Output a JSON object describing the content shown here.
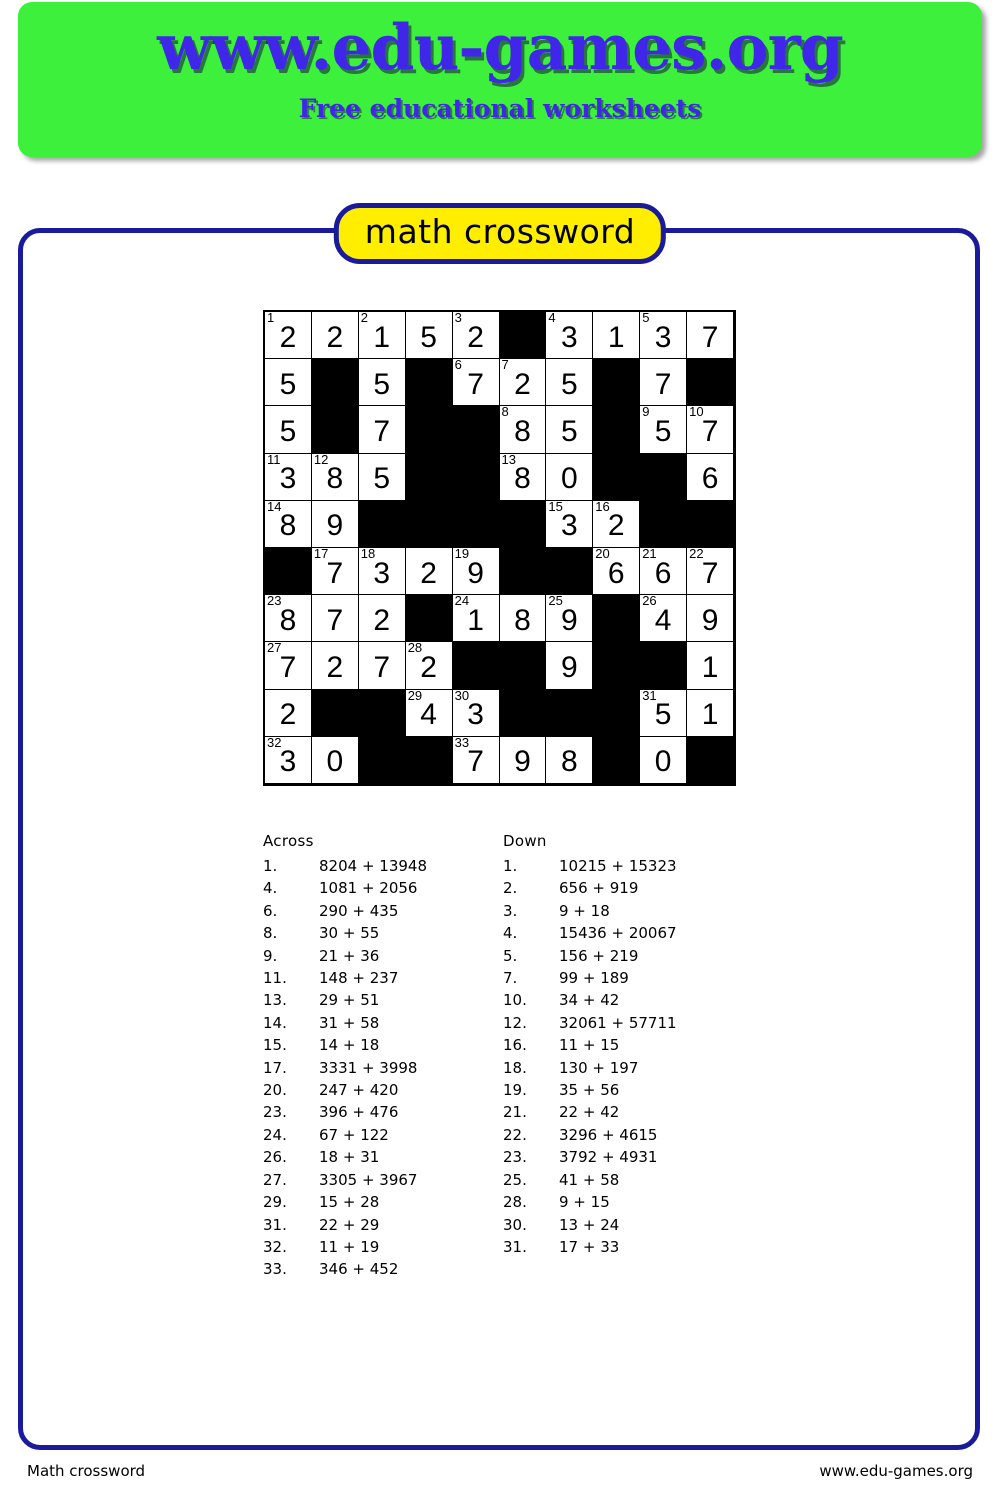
{
  "banner": {
    "title": "www.edu-games.org",
    "subtitle": "Free educational worksheets",
    "bg_color": "#3cf03c",
    "text_color": "#4026e8"
  },
  "title_badge": {
    "label": "math crossword",
    "bg_color": "#ffee00",
    "border_color": "#1a1a9c"
  },
  "footer": {
    "left": "Math crossword",
    "right": "www.edu-games.org"
  },
  "grid": {
    "rows": 10,
    "cols": 10,
    "cells": [
      [
        {
          "v": "2",
          "n": "1"
        },
        {
          "v": "2"
        },
        {
          "v": "1",
          "n": "2"
        },
        {
          "v": "5"
        },
        {
          "v": "2",
          "n": "3"
        },
        null,
        {
          "v": "3",
          "n": "4"
        },
        {
          "v": "1"
        },
        {
          "v": "3",
          "n": "5"
        },
        {
          "v": "7"
        }
      ],
      [
        {
          "v": "5"
        },
        null,
        {
          "v": "5"
        },
        null,
        {
          "v": "7",
          "n": "6"
        },
        {
          "v": "2",
          "n": "7"
        },
        {
          "v": "5"
        },
        null,
        {
          "v": "7"
        },
        null
      ],
      [
        {
          "v": "5"
        },
        null,
        {
          "v": "7"
        },
        null,
        null,
        {
          "v": "8",
          "n": "8"
        },
        {
          "v": "5"
        },
        null,
        {
          "v": "5",
          "n": "9"
        },
        {
          "v": "7",
          "n": "10"
        }
      ],
      [
        {
          "v": "3",
          "n": "11"
        },
        {
          "v": "8",
          "n": "12"
        },
        {
          "v": "5"
        },
        null,
        null,
        {
          "v": "8",
          "n": "13"
        },
        {
          "v": "0"
        },
        null,
        null,
        {
          "v": "6"
        }
      ],
      [
        {
          "v": "8",
          "n": "14"
        },
        {
          "v": "9"
        },
        null,
        null,
        null,
        null,
        {
          "v": "3",
          "n": "15"
        },
        {
          "v": "2",
          "n": "16"
        },
        null,
        null
      ],
      [
        null,
        {
          "v": "7",
          "n": "17"
        },
        {
          "v": "3",
          "n": "18"
        },
        {
          "v": "2"
        },
        {
          "v": "9",
          "n": "19"
        },
        null,
        null,
        {
          "v": "6",
          "n": "20"
        },
        {
          "v": "6",
          "n": "21"
        },
        {
          "v": "7",
          "n": "22"
        }
      ],
      [
        {
          "v": "8",
          "n": "23"
        },
        {
          "v": "7"
        },
        {
          "v": "2"
        },
        null,
        {
          "v": "1",
          "n": "24"
        },
        {
          "v": "8"
        },
        {
          "v": "9",
          "n": "25"
        },
        null,
        {
          "v": "4",
          "n": "26"
        },
        {
          "v": "9"
        }
      ],
      [
        {
          "v": "7",
          "n": "27"
        },
        {
          "v": "2"
        },
        {
          "v": "7"
        },
        {
          "v": "2",
          "n": "28"
        },
        null,
        null,
        {
          "v": "9"
        },
        null,
        null,
        {
          "v": "1"
        }
      ],
      [
        {
          "v": "2"
        },
        null,
        null,
        {
          "v": "4",
          "n": "29"
        },
        {
          "v": "3",
          "n": "30"
        },
        null,
        null,
        null,
        {
          "v": "5",
          "n": "31"
        },
        {
          "v": "1"
        }
      ],
      [
        {
          "v": "3",
          "n": "32"
        },
        {
          "v": "0"
        },
        null,
        null,
        {
          "v": "7",
          "n": "33"
        },
        {
          "v": "9"
        },
        {
          "v": "8"
        },
        null,
        {
          "v": "0"
        },
        null
      ]
    ]
  },
  "clues": {
    "across": {
      "heading": "Across",
      "items": [
        {
          "num": "1.",
          "text": "8204 + 13948"
        },
        {
          "num": "4.",
          "text": "1081 + 2056"
        },
        {
          "num": "6.",
          "text": "290 + 435"
        },
        {
          "num": "8.",
          "text": "30 + 55"
        },
        {
          "num": "9.",
          "text": "21 + 36"
        },
        {
          "num": "11.",
          "text": "148 + 237"
        },
        {
          "num": "13.",
          "text": "29 + 51"
        },
        {
          "num": "14.",
          "text": "31 + 58"
        },
        {
          "num": "15.",
          "text": "14 + 18"
        },
        {
          "num": "17.",
          "text": "3331 + 3998"
        },
        {
          "num": "20.",
          "text": "247 + 420"
        },
        {
          "num": "23.",
          "text": "396 + 476"
        },
        {
          "num": "24.",
          "text": "67 + 122"
        },
        {
          "num": "26.",
          "text": "18 + 31"
        },
        {
          "num": "27.",
          "text": "3305 + 3967"
        },
        {
          "num": "29.",
          "text": "15 + 28"
        },
        {
          "num": "31.",
          "text": "22 + 29"
        },
        {
          "num": "32.",
          "text": "11 + 19"
        },
        {
          "num": "33.",
          "text": "346 + 452"
        }
      ]
    },
    "down": {
      "heading": "Down",
      "items": [
        {
          "num": "1.",
          "text": "10215 + 15323"
        },
        {
          "num": "2.",
          "text": "656 + 919"
        },
        {
          "num": "3.",
          "text": "9 + 18"
        },
        {
          "num": "4.",
          "text": "15436 + 20067"
        },
        {
          "num": "5.",
          "text": "156 + 219"
        },
        {
          "num": "7.",
          "text": "99 + 189"
        },
        {
          "num": "10.",
          "text": "34 + 42"
        },
        {
          "num": "12.",
          "text": "32061 + 57711"
        },
        {
          "num": "16.",
          "text": "11 + 15"
        },
        {
          "num": "18.",
          "text": "130 + 197"
        },
        {
          "num": "19.",
          "text": "35 + 56"
        },
        {
          "num": "21.",
          "text": "22 + 42"
        },
        {
          "num": "22.",
          "text": "3296 + 4615"
        },
        {
          "num": "23.",
          "text": "3792 + 4931"
        },
        {
          "num": "25.",
          "text": "41 + 58"
        },
        {
          "num": "28.",
          "text": "9 + 15"
        },
        {
          "num": "30.",
          "text": "13 + 24"
        },
        {
          "num": "31.",
          "text": "17 + 33"
        }
      ]
    }
  }
}
